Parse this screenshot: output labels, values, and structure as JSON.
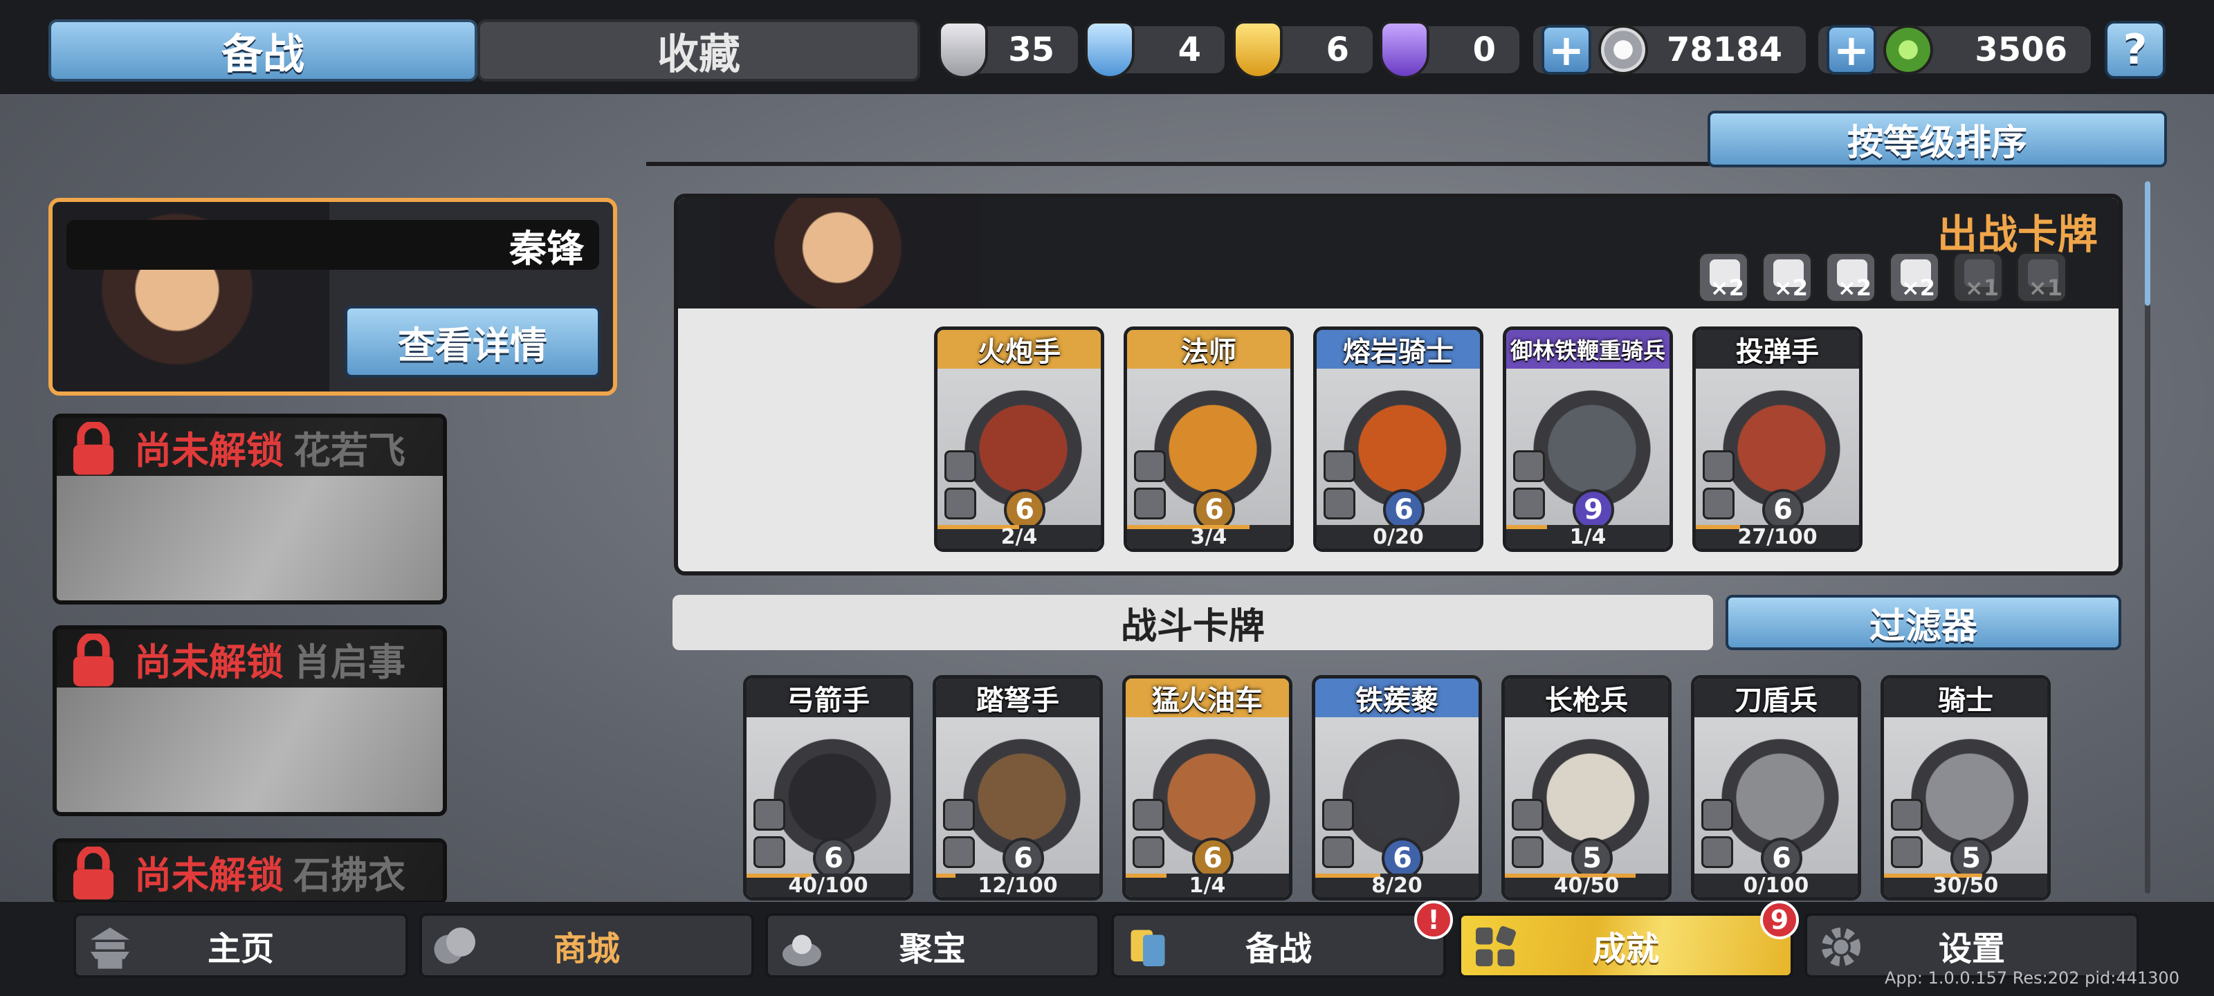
{
  "top_tabs": [
    {
      "label": "备战"
    },
    {
      "label": "收藏"
    }
  ],
  "resources": [
    {
      "icon": "silver-token-icon",
      "value": "35"
    },
    {
      "icon": "blue-crystal-icon",
      "value": "4"
    },
    {
      "icon": "gold-crest-icon",
      "value": "6"
    },
    {
      "icon": "purple-crest-icon",
      "value": "0"
    }
  ],
  "currency": [
    {
      "icon": "silver-coin-icon",
      "value": "78184"
    },
    {
      "icon": "jade-coin-icon",
      "value": "3506"
    }
  ],
  "help_symbol": "?",
  "sort_button": "按等级排序",
  "hero": {
    "name": "秦锋",
    "details_button": "查看详情"
  },
  "locked_heroes": [
    {
      "status": "尚未解锁",
      "name": "花若飞"
    },
    {
      "status": "尚未解锁",
      "name": "肖启事"
    },
    {
      "status": "尚未解锁",
      "name": "石拂衣"
    }
  ],
  "deck": {
    "title": "出战卡牌",
    "traits": [
      {
        "icon": "spear-trait-icon",
        "count": "×2"
      },
      {
        "icon": "horse-trait-icon",
        "count": "×2"
      },
      {
        "icon": "skull-trait-icon",
        "count": "×2"
      },
      {
        "icon": "shield-trait-icon",
        "count": "×2"
      },
      {
        "icon": "helmet-trait-icon",
        "count": "×1"
      },
      {
        "icon": "dragon-trait-icon",
        "count": "×1"
      }
    ],
    "cards": [
      {
        "name": "火炮手",
        "level": "6",
        "count": "2/4",
        "progress": 0.5,
        "rarity": "gold"
      },
      {
        "name": "法师",
        "level": "6",
        "count": "3/4",
        "progress": 0.75,
        "rarity": "gold"
      },
      {
        "name": "熔岩骑士",
        "level": "6",
        "count": "0/20",
        "progress": 0,
        "rarity": "blue"
      },
      {
        "name": "御林铁鞭重骑兵",
        "level": "9",
        "count": "1/4",
        "progress": 0.25,
        "rarity": "purple"
      },
      {
        "name": "投弹手",
        "level": "6",
        "count": "27/100",
        "progress": 0.27,
        "rarity": "grey"
      }
    ]
  },
  "battle_cards_title": "战斗卡牌",
  "filter_button": "过滤器",
  "battle_cards": [
    {
      "name": "弓箭手",
      "level": "6",
      "count": "40/100",
      "progress": 0.4,
      "rarity": "grey"
    },
    {
      "name": "踏弩手",
      "level": "6",
      "count": "12/100",
      "progress": 0.12,
      "rarity": "grey"
    },
    {
      "name": "猛火油车",
      "level": "6",
      "count": "1/4",
      "progress": 0.25,
      "rarity": "gold"
    },
    {
      "name": "铁蒺藜",
      "level": "6",
      "count": "8/20",
      "progress": 0.4,
      "rarity": "blue"
    },
    {
      "name": "长枪兵",
      "level": "5",
      "count": "40/50",
      "progress": 0.8,
      "rarity": "grey"
    },
    {
      "name": "刀盾兵",
      "level": "6",
      "count": "0/100",
      "progress": 0,
      "rarity": "grey"
    },
    {
      "name": "骑士",
      "level": "5",
      "count": "30/50",
      "progress": 0.6,
      "rarity": "grey"
    }
  ],
  "nav": [
    {
      "label": "主页",
      "icon": "pagoda-icon"
    },
    {
      "label": "商城",
      "icon": "coins-icon"
    },
    {
      "label": "聚宝",
      "icon": "treasure-icon"
    },
    {
      "label": "备战",
      "icon": "cards-icon",
      "badge": "!"
    },
    {
      "label": "成就",
      "icon": "achievement-icon",
      "badge": "9"
    },
    {
      "label": "设置",
      "icon": "gear-icon"
    }
  ],
  "version_text": "App: 1.0.0.157 Res:202 pid:441300",
  "colors": {
    "accent_blue": "#5e9bcc",
    "gold": "#f0a64a",
    "title_gold": "#f0a64a",
    "unlock_red": "#e23b3b"
  }
}
